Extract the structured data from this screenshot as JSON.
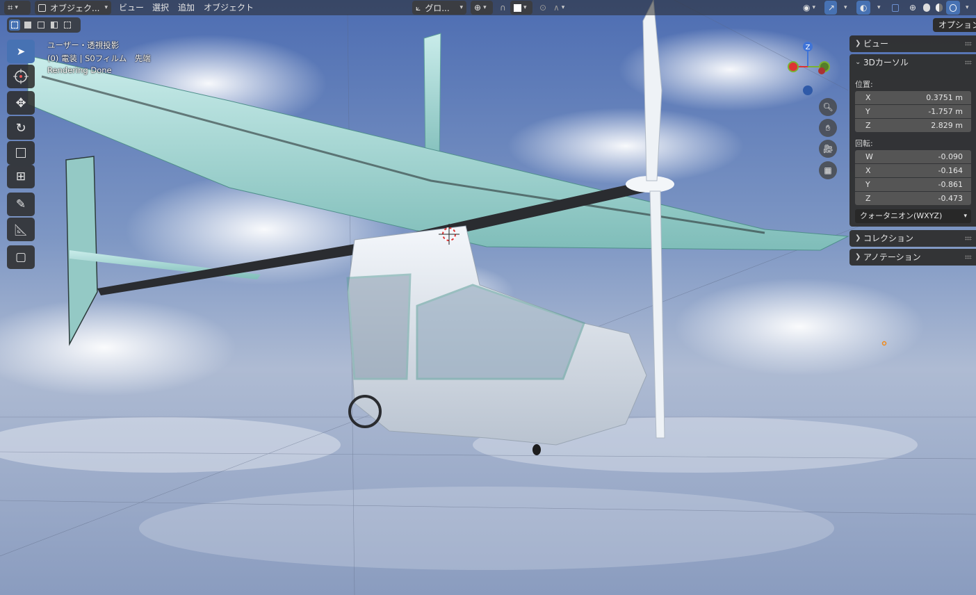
{
  "header": {
    "mode_label": "オブジェク...",
    "menu": [
      "ビュー",
      "選択",
      "追加",
      "オブジェクト"
    ],
    "orientation_label": "グロ..."
  },
  "overlay": {
    "view_name": "ユーザー・透視投影",
    "collection_info": "(0) 電装 | S0フィルム　先端",
    "status": "Rendering Done"
  },
  "gizmo": {
    "axis_z_label": "Z"
  },
  "sidebar": {
    "options_button": "オプション",
    "view_panel": "ビュー",
    "cursor_panel": {
      "title": "3Dカーソル",
      "location_label": "位置:",
      "location": [
        {
          "axis": "X",
          "value": "0.3751 m"
        },
        {
          "axis": "Y",
          "value": "-1.757 m"
        },
        {
          "axis": "Z",
          "value": "2.829 m"
        }
      ],
      "rotation_label": "回転:",
      "rotation": [
        {
          "axis": "W",
          "value": "-0.090"
        },
        {
          "axis": "X",
          "value": "-0.164"
        },
        {
          "axis": "Y",
          "value": "-0.861"
        },
        {
          "axis": "Z",
          "value": "-0.473"
        }
      ],
      "rotation_mode": "クォータニオン(WXYZ)"
    },
    "collection_panel": "コレクション",
    "annotation_panel": "アノテーション"
  }
}
